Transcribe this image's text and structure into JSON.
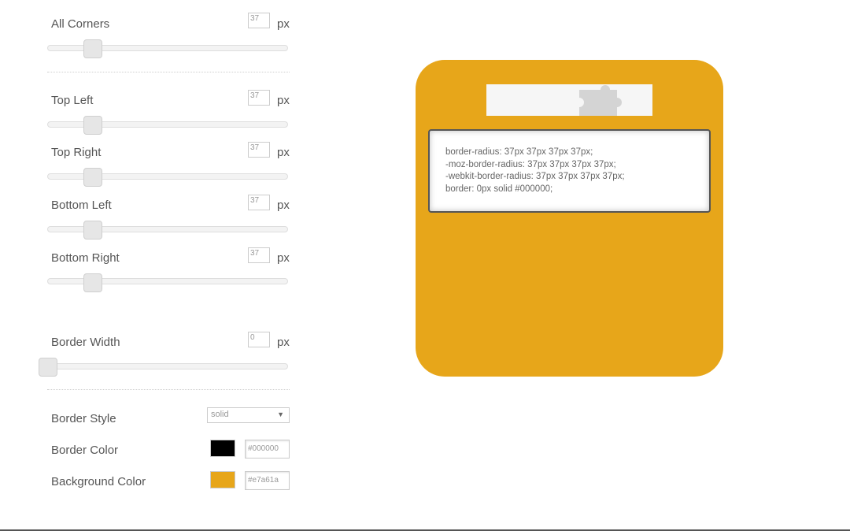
{
  "unit": "px",
  "corners": {
    "all": {
      "label": "All Corners",
      "value": "37",
      "slider_max": 200
    },
    "top_left": {
      "label": "Top Left",
      "value": "37",
      "slider_max": 200
    },
    "top_right": {
      "label": "Top Right",
      "value": "37",
      "slider_max": 200
    },
    "bottom_left": {
      "label": "Bottom Left",
      "value": "37",
      "slider_max": 200
    },
    "bottom_right": {
      "label": "Bottom Right",
      "value": "37",
      "slider_max": 200
    }
  },
  "border_width": {
    "label": "Border Width",
    "value": "0",
    "slider_max": 50
  },
  "border_style": {
    "label": "Border Style",
    "value": "solid"
  },
  "border_color": {
    "label": "Border Color",
    "value": "#000000",
    "swatch": "#000000"
  },
  "background_color": {
    "label": "Background Color",
    "value": "#e7a61a",
    "swatch": "#e7a61a"
  },
  "preview": {
    "code_lines": [
      "border-radius: 37px 37px 37px 37px;",
      "-moz-border-radius: 37px 37px 37px 37px;",
      "-webkit-border-radius: 37px 37px 37px 37px;",
      "border: 0px solid #000000;"
    ]
  }
}
